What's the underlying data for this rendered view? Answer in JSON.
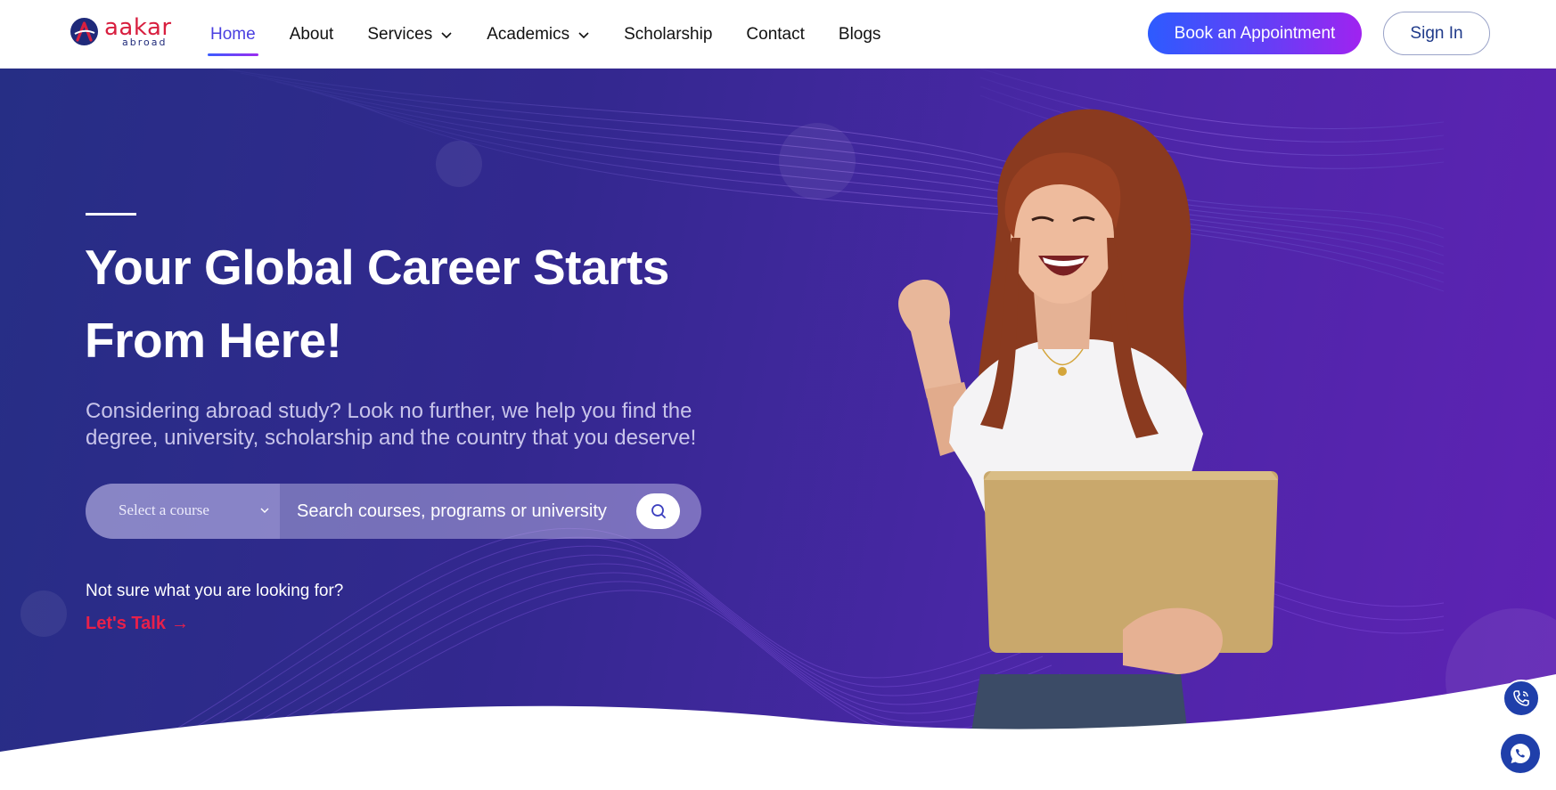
{
  "brand": {
    "name": "aakar",
    "tagline": "abroad",
    "accent_color": "#d81f3f",
    "primary_color": "#1f2a7a"
  },
  "nav": {
    "items": [
      {
        "label": "Home",
        "active": true
      },
      {
        "label": "About"
      },
      {
        "label": "Services",
        "has_dropdown": true
      },
      {
        "label": "Academics",
        "has_dropdown": true
      },
      {
        "label": "Scholarship"
      },
      {
        "label": "Contact"
      },
      {
        "label": "Blogs"
      }
    ],
    "cta_label": "Book an Appointment",
    "signin_label": "Sign In"
  },
  "hero": {
    "title_line1": "Your Global Career Starts",
    "title_line2": "From Here!",
    "subtitle_line1": "Considering abroad study? Look no further, we help you find the",
    "subtitle_line2": "degree, university, scholarship and the country that you deserve!",
    "search": {
      "course_select_label": "Select a course",
      "placeholder": "Search courses, programs or university"
    },
    "help_text": "Not sure what you are looking for?",
    "help_link": "Let's Talk",
    "background_colors": [
      "#262e85",
      "#5f22b4"
    ]
  },
  "floating": {
    "phone_icon": "phone-call-icon",
    "whatsapp_icon": "whatsapp-icon"
  }
}
